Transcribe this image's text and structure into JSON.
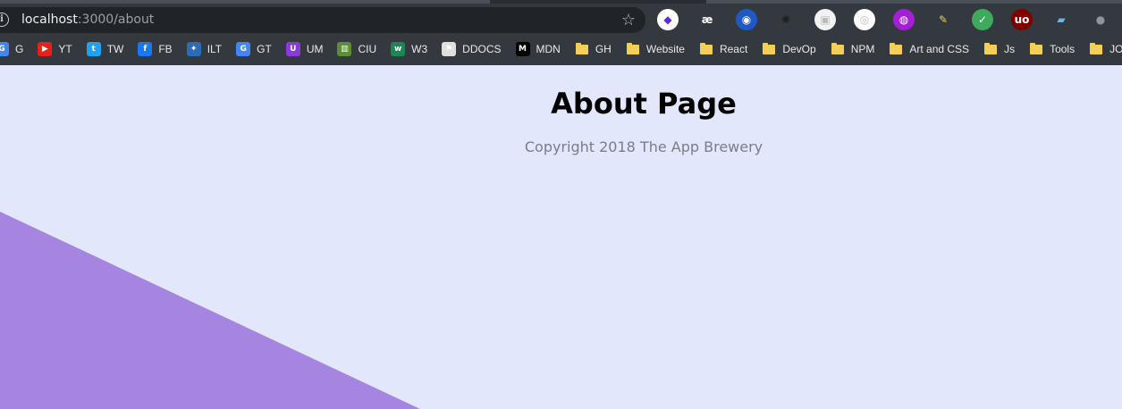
{
  "browser": {
    "url_host": "localhost",
    "url_path": ":3000/about",
    "extensions": [
      {
        "name": "extension-1",
        "glyph": "◆",
        "color": "#5b2bd6",
        "bg": "#ffffff"
      },
      {
        "name": "extension-2",
        "glyph": "æ",
        "color": "#ffffff",
        "bg": "transparent"
      },
      {
        "name": "bitwarden",
        "glyph": "◉",
        "color": "#ffffff",
        "bg": "#1f58c7"
      },
      {
        "name": "extension-4",
        "glyph": "✺",
        "color": "#1d1f22",
        "bg": "transparent"
      },
      {
        "name": "extension-5",
        "glyph": "▣",
        "color": "#bbbbbb",
        "bg": "#f2f2f2"
      },
      {
        "name": "extension-6",
        "glyph": "◎",
        "color": "#bbbbbb",
        "bg": "#ffffff"
      },
      {
        "name": "extension-7",
        "glyph": "◍",
        "color": "#ffffff",
        "bg": "#a21fd6"
      },
      {
        "name": "extension-8",
        "glyph": "✎",
        "color": "#f3cf55",
        "bg": "transparent"
      },
      {
        "name": "extension-9",
        "glyph": "✓",
        "color": "#ffffff",
        "bg": "#3daa5c"
      },
      {
        "name": "ublock",
        "glyph": "uo",
        "color": "#ffffff",
        "bg": "#800000"
      },
      {
        "name": "extension-11",
        "glyph": "▰",
        "color": "#6eb3e8",
        "bg": "transparent"
      },
      {
        "name": "extension-12",
        "glyph": "●",
        "color": "#8f949b",
        "bg": "transparent"
      }
    ]
  },
  "bookmarks": [
    {
      "label": "G",
      "icon": "google-icon",
      "bg": "#4285f4",
      "glyph": "G"
    },
    {
      "label": "YT",
      "icon": "youtube-icon",
      "bg": "#e62117",
      "glyph": "▶"
    },
    {
      "label": "TW",
      "icon": "twitter-icon",
      "bg": "#1da1f2",
      "glyph": "t"
    },
    {
      "label": "FB",
      "icon": "facebook-icon",
      "bg": "#1877f2",
      "glyph": "f"
    },
    {
      "label": "ILT",
      "icon": "ilt-icon",
      "bg": "#2c6cb5",
      "glyph": "✦"
    },
    {
      "label": "GT",
      "icon": "google-translate-icon",
      "bg": "#4285f4",
      "glyph": "G"
    },
    {
      "label": "UM",
      "icon": "um-icon",
      "bg": "#8a3ad6",
      "glyph": "U"
    },
    {
      "label": "CIU",
      "icon": "caniuse-icon",
      "bg": "#5b8e36",
      "glyph": "▥"
    },
    {
      "label": "W3",
      "icon": "w3-icon",
      "bg": "#1a8754",
      "glyph": "w"
    },
    {
      "label": "DDOCS",
      "icon": "devdocs-icon",
      "bg": "#e0e0e0",
      "glyph": "⚑"
    },
    {
      "label": "MDN",
      "icon": "mdn-icon",
      "bg": "#000000",
      "glyph": "M"
    },
    {
      "label": "GH",
      "icon": "folder-icon",
      "folder": true
    },
    {
      "label": "Website",
      "icon": "folder-icon",
      "folder": true
    },
    {
      "label": "React",
      "icon": "folder-icon",
      "folder": true
    },
    {
      "label": "DevOp",
      "icon": "folder-icon",
      "folder": true
    },
    {
      "label": "NPM",
      "icon": "folder-icon",
      "folder": true
    },
    {
      "label": "Art and CSS",
      "icon": "folder-icon",
      "folder": true
    },
    {
      "label": "Js",
      "icon": "folder-icon",
      "folder": true
    },
    {
      "label": "Tools",
      "icon": "folder-icon",
      "folder": true
    },
    {
      "label": "JOB_D",
      "icon": "folder-icon",
      "folder": true
    }
  ],
  "page": {
    "title": "About Page",
    "copyright": "Copyright 2018 The App Brewery",
    "background_color": "#e2e7fb",
    "accent_color": "#a585e0"
  }
}
